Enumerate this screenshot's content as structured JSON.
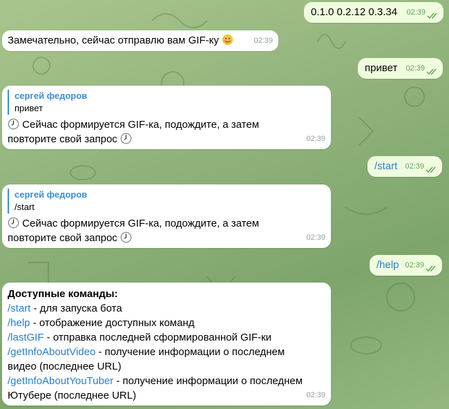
{
  "messages": {
    "m1": {
      "text": "0.1.0 0.2.12 0.3.34",
      "time": "02:39"
    },
    "m2": {
      "text": "Замечательно, сейчас отправлю вам GIF-ку",
      "time": "02:39"
    },
    "m3": {
      "text": "привет",
      "time": "02:39"
    },
    "m4": {
      "reply_name": "сергей федоров",
      "reply_text": "привет",
      "line1": " Сейчас формируется GIF-ка, подождите, а затем",
      "line2": "повторите свой запрос ",
      "time": "02:39"
    },
    "m5": {
      "text": "/start",
      "time": "02:39"
    },
    "m6": {
      "reply_name": "сергей федоров",
      "reply_text": "/start",
      "line1": " Сейчас формируется GIF-ка, подождите, а затем",
      "line2": "повторите свой запрос ",
      "time": "02:39"
    },
    "m7": {
      "text": "/help",
      "time": "02:39"
    },
    "m8": {
      "title": "Доступные команды:",
      "c1": "/start",
      "d1": " - для запуска бота",
      "c2": "/help",
      "d2": " - отображение доступных команд",
      "c3": "/lastGIF",
      "d3": " - отправка последней сформированной GIF-ки",
      "c4": "/getInfoAboutVideo",
      "d4": " - получение информации о последнем",
      "d4b": "видео (последнее URL)",
      "c5": "/getInfoAboutYouTuber",
      "d5": " - получение информации о последнем",
      "d5b": "Ютубере (последнее URL)",
      "time": "02:39"
    }
  },
  "colors": {
    "link": "#2a7fc9",
    "reply_accent": "#3a8fd6",
    "outgoing_bg": "#effdde",
    "incoming_bg": "#ffffff"
  },
  "icons": [
    "clock-icon",
    "smiling-face-emoji",
    "double-check-icon"
  ]
}
